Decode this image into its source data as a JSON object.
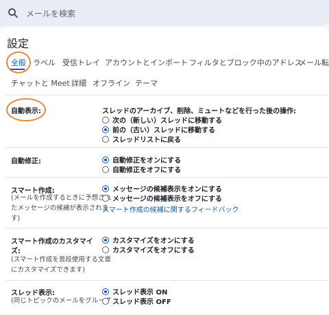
{
  "search": {
    "placeholder": "メールを検索",
    "icon": "search-icon"
  },
  "page_title": "設定",
  "tabs_row1": [
    {
      "label": "全般",
      "active": true
    },
    {
      "label": "ラベル"
    },
    {
      "label": "受信トレイ"
    },
    {
      "label": "アカウントとインポート"
    },
    {
      "label": "フィルタとブロック中のアドレス"
    },
    {
      "label": "メール転送"
    }
  ],
  "tabs_row2": [
    {
      "label": "チャットと Meet"
    },
    {
      "label": "詳細"
    },
    {
      "label": "オフライン"
    },
    {
      "label": "テーマ"
    }
  ],
  "settings": {
    "auto_advance": {
      "label": "自動表示:",
      "heading": "スレッドのアーカイブ、削除、ミュートなどを行った後の操作:",
      "options": [
        {
          "label": "次の（新しい）スレッドに移動する",
          "selected": false
        },
        {
          "label": "前の（古い）スレッドに移動する",
          "selected": true
        },
        {
          "label": "スレッドリストに戻る",
          "selected": false
        }
      ]
    },
    "autocorrect": {
      "label": "自動修正:",
      "options": [
        {
          "label": "自動修正をオンにする",
          "selected": true
        },
        {
          "label": "自動修正をオフにする",
          "selected": false
        }
      ]
    },
    "smart_compose": {
      "label": "スマート作成:",
      "sub": [
        "(メールを作成するときに予想され",
        "たメッセージの候補が表示されま",
        "す)"
      ],
      "options": [
        {
          "label": "メッセージの候補表示をオンにする",
          "selected": true
        },
        {
          "label": "メッセージの候補表示をオフにする",
          "selected": false
        }
      ],
      "feedback_link": "スマート作成の候補に関するフィードバック"
    },
    "smart_compose_personalization": {
      "label_lines": [
        "スマート作成のカスタマイ",
        "ズ:"
      ],
      "sub": [
        "(スマート作成を普段使用する文章",
        "にカスタマイズできます)"
      ],
      "options": [
        {
          "label": "カスタマイズをオンにする",
          "selected": true
        },
        {
          "label": "カスタマイズをオフにする",
          "selected": false
        }
      ]
    },
    "conversation_view": {
      "label": "スレッド表示:",
      "sub": [
        "(同じトピックのメールをグループ"
      ],
      "options": [
        {
          "label": "スレッド表示 ON",
          "selected": true
        },
        {
          "label": "スレッド表示 OFF",
          "selected": false
        }
      ]
    }
  },
  "colors": {
    "accent": "#0b57d0",
    "annotation": "#e8893a"
  }
}
